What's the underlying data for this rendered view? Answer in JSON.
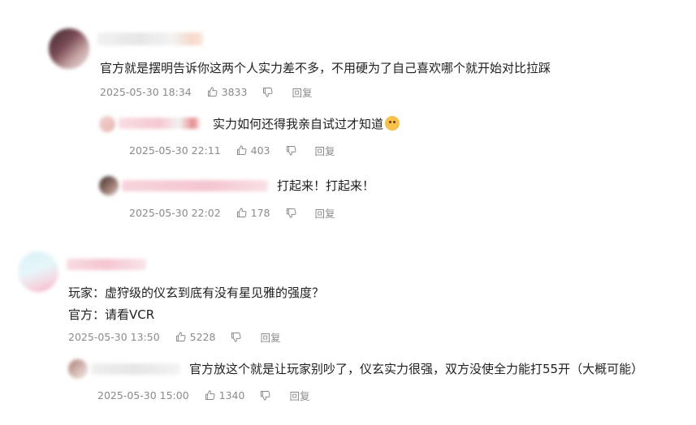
{
  "comments": [
    {
      "text": "官方就是摆明告诉你这两个人实力差不多，不用硬为了自己喜欢哪个就开始对比拉踩",
      "time": "2025-05-30 18:34",
      "likes": "3833",
      "reply_label": "回复",
      "replies": [
        {
          "text": "实力如何还得我亲自试过才知道",
          "time": "2025-05-30 22:11",
          "likes": "403",
          "reply_label": "回复",
          "emoji": "cat-face-icon"
        },
        {
          "text": "打起来！打起来！",
          "time": "2025-05-30 22:02",
          "likes": "178",
          "reply_label": "回复"
        }
      ]
    },
    {
      "lines": [
        "玩家：虚狩级的仪玄到底有没有星见雅的强度？",
        "官方：请看VCR"
      ],
      "time": "2025-05-30 13:50",
      "likes": "5228",
      "reply_label": "回复",
      "replies": [
        {
          "text": "官方放这个就是让玩家别吵了，仪玄实力很强，双方没使全力能打55开（大概可能）",
          "time": "2025-05-30 15:00",
          "likes": "1340",
          "reply_label": "回复"
        }
      ]
    }
  ],
  "colors": {
    "text": "#1f1f1f",
    "meta": "#8a8a8a",
    "name_blur": "#f4c7cf"
  }
}
